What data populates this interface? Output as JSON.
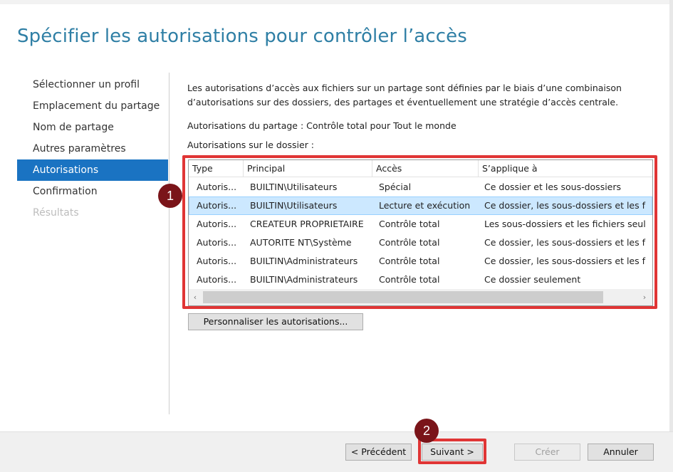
{
  "page": {
    "title": "Spécifier les autorisations pour contrôler l’accès"
  },
  "nav": {
    "items": [
      {
        "label": "Sélectionner un profil",
        "state": "normal"
      },
      {
        "label": "Emplacement du partage",
        "state": "normal"
      },
      {
        "label": "Nom de partage",
        "state": "normal"
      },
      {
        "label": "Autres paramètres",
        "state": "normal"
      },
      {
        "label": "Autorisations",
        "state": "active"
      },
      {
        "label": "Confirmation",
        "state": "normal"
      },
      {
        "label": "Résultats",
        "state": "disabled"
      }
    ]
  },
  "content": {
    "description": "Les autorisations d’accès aux fichiers sur un partage sont définies par le biais d’une combinaison d’autorisations sur des dossiers, des partages et éventuellement une stratégie d’accès centrale.",
    "share_permissions": "Autorisations du partage : Contrôle total pour Tout le monde",
    "folder_permissions_label": "Autorisations sur le dossier :",
    "customize_button": "Personnaliser les autorisations..."
  },
  "table": {
    "columns": [
      "Type",
      "Principal",
      "Accès",
      "S’applique à"
    ],
    "rows": [
      [
        "Autoris...",
        "BUILTIN\\Utilisateurs",
        "Spécial",
        "Ce dossier et les sous-dossiers"
      ],
      [
        "Autoris...",
        "BUILTIN\\Utilisateurs",
        "Lecture et exécution",
        "Ce dossier, les sous-dossiers et les f"
      ],
      [
        "Autoris...",
        "CREATEUR PROPRIETAIRE",
        "Contrôle total",
        "Les sous-dossiers et les fichiers seul"
      ],
      [
        "Autoris...",
        "AUTORITE NT\\Système",
        "Contrôle total",
        "Ce dossier, les sous-dossiers et les f"
      ],
      [
        "Autoris...",
        "BUILTIN\\Administrateurs",
        "Contrôle total",
        "Ce dossier, les sous-dossiers et les f"
      ],
      [
        "Autoris...",
        "BUILTIN\\Administrateurs",
        "Contrôle total",
        "Ce dossier seulement"
      ]
    ],
    "selected_row": 1
  },
  "footer": {
    "previous": "< Précédent",
    "next": "Suivant >",
    "create": "Créer",
    "cancel": "Annuler"
  },
  "annotations": {
    "badge1": "1",
    "badge2": "2"
  },
  "colors": {
    "title": "#2f7fa5",
    "nav_active": "#1a73c2",
    "highlight": "#e03535",
    "badge": "#7a1419",
    "row_selected": "#cce8ff"
  }
}
